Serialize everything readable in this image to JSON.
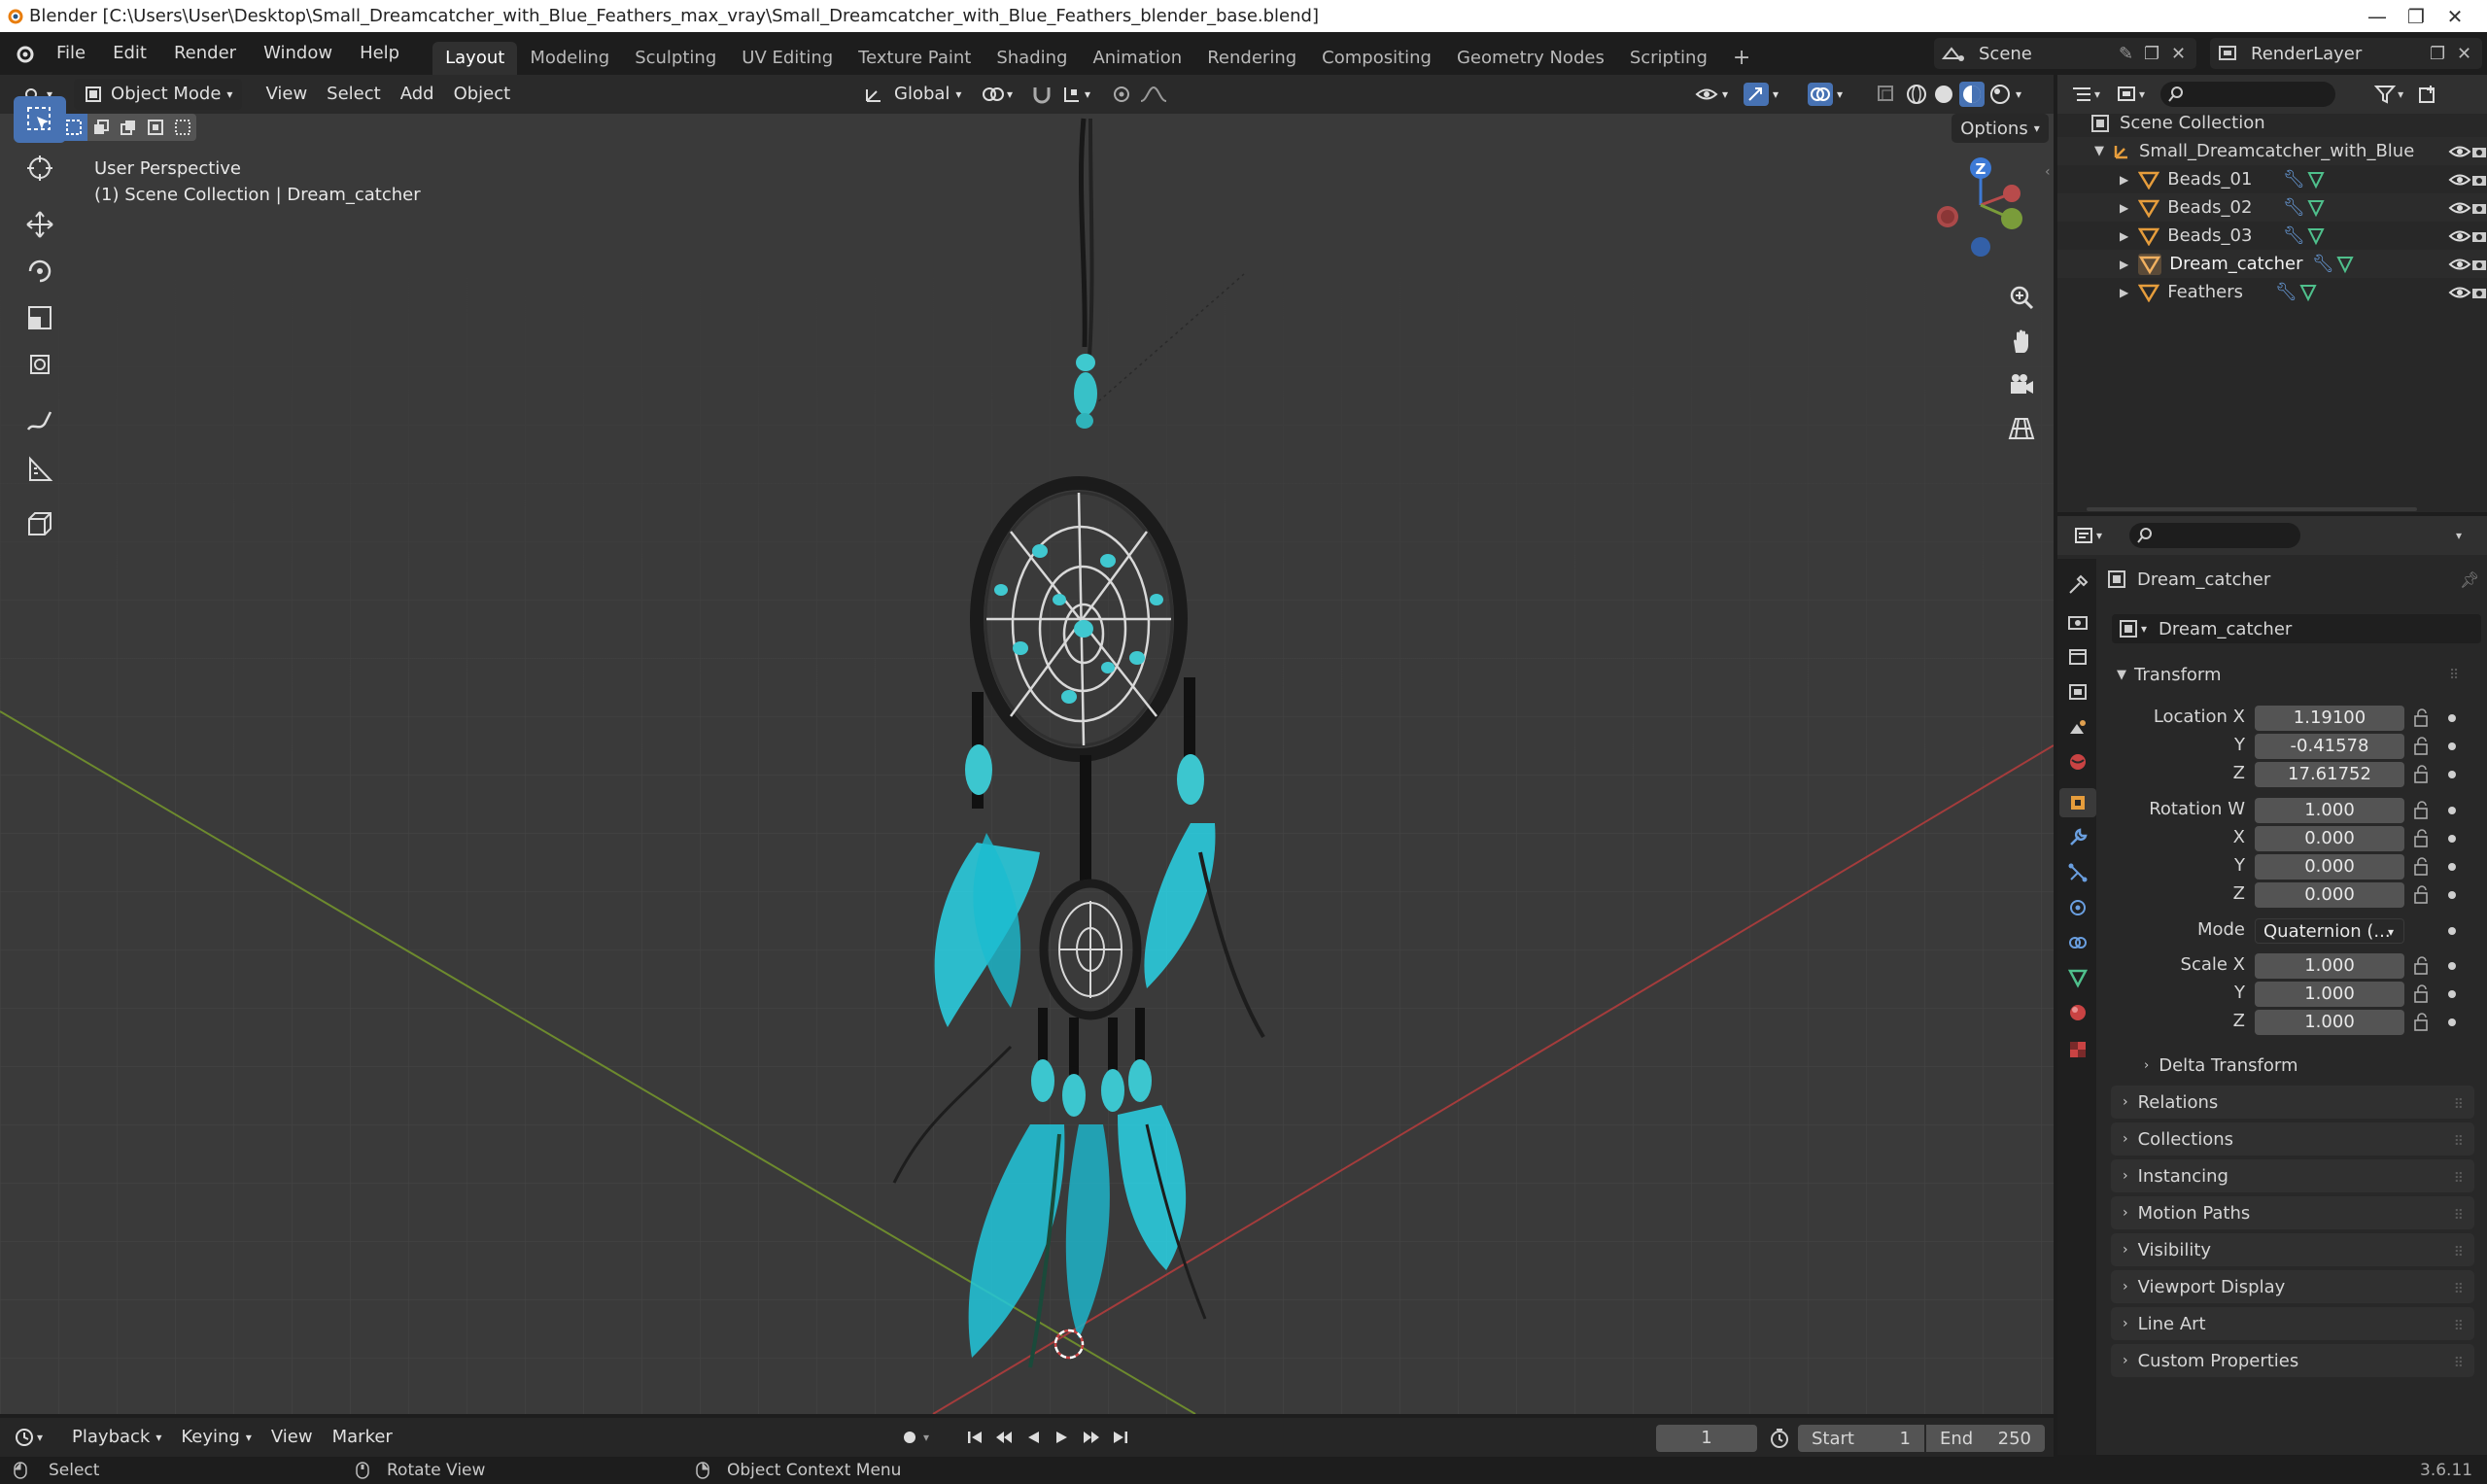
{
  "window": {
    "title": "Blender [C:\\Users\\User\\Desktop\\Small_Dreamcatcher_with_Blue_Feathers_max_vray\\Small_Dreamcatcher_with_Blue_Feathers_blender_base.blend]"
  },
  "menu": [
    "File",
    "Edit",
    "Render",
    "Window",
    "Help"
  ],
  "workspaces": [
    "Layout",
    "Modeling",
    "Sculpting",
    "UV Editing",
    "Texture Paint",
    "Shading",
    "Animation",
    "Rendering",
    "Compositing",
    "Geometry Nodes",
    "Scripting"
  ],
  "active_workspace": "Layout",
  "scene": {
    "name": "Scene",
    "view_layer": "RenderLayer"
  },
  "viewport": {
    "mode": "Object Mode",
    "menus": [
      "View",
      "Select",
      "Add",
      "Object"
    ],
    "transform_orientation": "Global",
    "options_label": "Options",
    "overlay_line1": "User Perspective",
    "overlay_line2": "(1) Scene Collection | Dream_catcher",
    "gizmo_axis": "Z"
  },
  "outliner": {
    "root": "Scene Collection",
    "collection": "Small_Dreamcatcher_with_Blue",
    "objects": [
      "Beads_01",
      "Beads_02",
      "Beads_03",
      "Dream_catcher",
      "Feathers"
    ]
  },
  "properties": {
    "object_name": "Dream_catcher",
    "datablock_name": "Dream_catcher",
    "transform_label": "Transform",
    "labels": {
      "location_x": "Location X",
      "y": "Y",
      "z": "Z",
      "rotation_w": "Rotation W",
      "x": "X",
      "mode": "Mode",
      "scale_x": "Scale X"
    },
    "location": [
      "1.19100",
      "-0.41578",
      "17.61752"
    ],
    "rotation": [
      "1.000",
      "0.000",
      "0.000",
      "0.000"
    ],
    "rotation_mode": "Quaternion (...",
    "scale": [
      "1.000",
      "1.000",
      "1.000"
    ],
    "delta_transform": "Delta Transform",
    "panels": [
      "Relations",
      "Collections",
      "Instancing",
      "Motion Paths",
      "Visibility",
      "Viewport Display",
      "Line Art",
      "Custom Properties"
    ]
  },
  "timeline": {
    "menus": [
      "Playback",
      "Keying",
      "View",
      "Marker"
    ],
    "current_frame": "1",
    "start_label": "Start",
    "start": "1",
    "end_label": "End",
    "end": "250"
  },
  "statusbar": {
    "select": "Select",
    "rotate_view": "Rotate View",
    "context_menu": "Object Context Menu",
    "version": "3.6.11"
  },
  "colors": {
    "accent": "#4772b3",
    "axis_x": "#b84b4b",
    "axis_y": "#7a9c3a",
    "axis_z": "#3d7ad6",
    "feather": "#2ad4e6"
  }
}
